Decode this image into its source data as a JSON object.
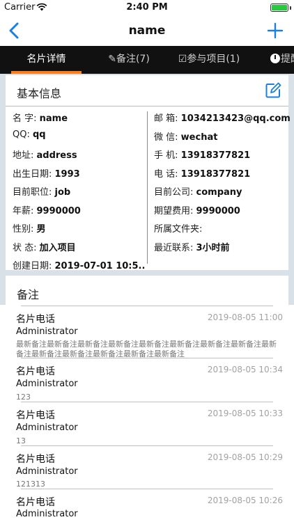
{
  "status_bar": {
    "carrier": "Carrier",
    "time": "2:40 PM",
    "battery_level": 1.0
  },
  "nav": {
    "title": "name"
  },
  "tabs": [
    {
      "label": "名片详情",
      "active": true
    },
    {
      "label": "✎备注(7)",
      "active": false
    },
    {
      "label": "☑参与项目(1)",
      "active": false
    },
    {
      "label": "提醒",
      "active": false
    }
  ],
  "basic_info": {
    "title": "基本信息",
    "rows": [
      {
        "left_label": "名 字: ",
        "left_value": "name",
        "right_label": "邮 箱: ",
        "right_value": "1034213423@qq.com"
      },
      {
        "left_label": "QQ: ",
        "left_value": "qq",
        "right_label": "微 信: ",
        "right_value": "wechat"
      },
      {
        "left_label": "地址: ",
        "left_value": "address",
        "right_label": "手 机: ",
        "right_value": "13918377821"
      },
      {
        "left_label": "出生日期: ",
        "left_value": "1993",
        "right_label": "电 话: ",
        "right_value": "13918377821"
      },
      {
        "left_label": "目前职位: ",
        "left_value": "job",
        "right_label": "目前公司: ",
        "right_value": "company"
      },
      {
        "left_label": "年薪: ",
        "left_value": "9990000",
        "right_label": "期望费用: ",
        "right_value": "9990000"
      },
      {
        "left_label": "性别: ",
        "left_value": "男",
        "right_label": "所属文件夹: ",
        "right_value": ""
      },
      {
        "left_label": "状 态: ",
        "left_value": "加入项目",
        "right_label": "最近联系: ",
        "right_value": "3小时前"
      },
      {
        "left_label": "创建日期: ",
        "left_value": "2019-07-01 10:5...",
        "right_label": "",
        "right_value": ""
      }
    ]
  },
  "notes": {
    "title": "备注",
    "items": [
      {
        "title": "名片电话",
        "time": "2019-08-05 11:00",
        "author": "Administrator",
        "note": "最新备注最新备注最新备注最新备注最新备注最新备注最新备注最新备注最新备注最新备注最新备注最新备注最新备注最新备注"
      },
      {
        "title": "名片电话",
        "time": "2019-08-05 10:34",
        "author": "Administrator",
        "note": "123"
      },
      {
        "title": "名片电话",
        "time": "2019-08-05 10:33",
        "author": "Administrator",
        "note": "13"
      },
      {
        "title": "名片电话",
        "time": "2019-08-05 10:29",
        "author": "Administrator",
        "note": "121313"
      },
      {
        "title": "名片电话",
        "time": "2019-08-05 10:26",
        "author": "Administrator",
        "note": ""
      }
    ]
  },
  "colors": {
    "accent": "#1a7fe0",
    "tab_bar": "#111111",
    "tab_indicator": "#ff7d1a",
    "content_bg": "#d8e1e7"
  }
}
